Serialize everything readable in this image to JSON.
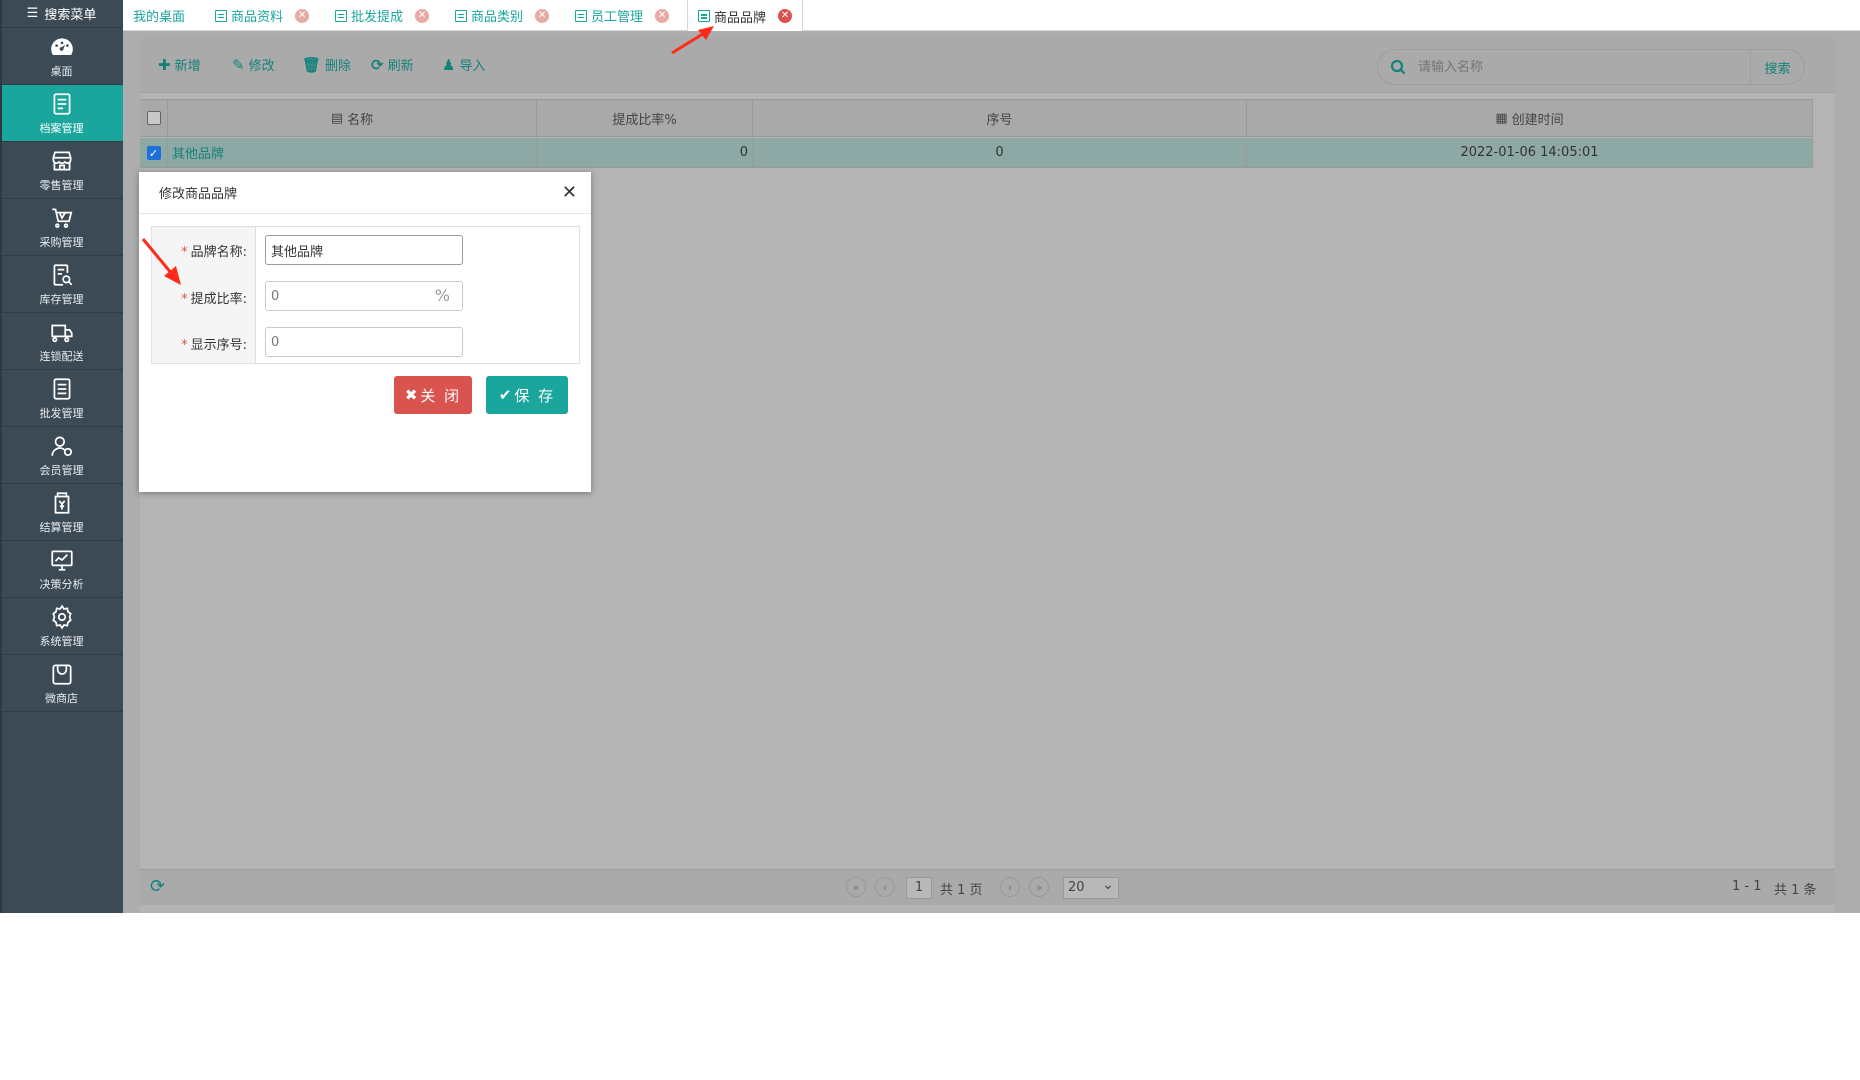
{
  "sidebar": {
    "search_label": "搜索菜单",
    "items": [
      {
        "label": "桌面",
        "icon": "dashboard-icon"
      },
      {
        "label": "档案管理",
        "icon": "archive-icon"
      },
      {
        "label": "零售管理",
        "icon": "store-icon"
      },
      {
        "label": "采购管理",
        "icon": "cart-icon"
      },
      {
        "label": "库存管理",
        "icon": "inventory-icon"
      },
      {
        "label": "连锁配送",
        "icon": "delivery-icon"
      },
      {
        "label": "批发管理",
        "icon": "wholesale-icon"
      },
      {
        "label": "会员管理",
        "icon": "member-icon"
      },
      {
        "label": "结算管理",
        "icon": "settlement-icon"
      },
      {
        "label": "决策分析",
        "icon": "analysis-icon"
      },
      {
        "label": "系统管理",
        "icon": "gear-icon"
      },
      {
        "label": "微商店",
        "icon": "shop-bag-icon"
      }
    ],
    "active_index": 1
  },
  "tabs": [
    {
      "label": "我的桌面"
    },
    {
      "label": "商品资料"
    },
    {
      "label": "批发提成"
    },
    {
      "label": "商品类别"
    },
    {
      "label": "员工管理"
    },
    {
      "label": "商品品牌"
    }
  ],
  "toolbar": {
    "add_label": "新增",
    "edit_label": "修改",
    "delete_label": "删除",
    "refresh_label": "刷新",
    "import_label": "导入",
    "search_placeholder": "请输入名称",
    "search_button": "搜索"
  },
  "grid": {
    "headers": {
      "name": "名称",
      "rate": "提成比率%",
      "order": "序号",
      "created": "创建时间"
    },
    "rows": [
      {
        "name": "其他品牌",
        "rate": "0",
        "order": "0",
        "created": "2022-01-06 14:05:01"
      }
    ]
  },
  "pager": {
    "page": "1",
    "total_pages": "共 1 页",
    "page_size": "20",
    "range": "1 - 1",
    "total": "共 1 条"
  },
  "dialog": {
    "title": "修改商品品牌",
    "fields": [
      {
        "label": "品牌名称:",
        "value": "其他品牌"
      },
      {
        "label": "提成比率:",
        "value": "0",
        "unit": "%"
      },
      {
        "label": "显示序号:",
        "value": "0"
      }
    ],
    "close_button": "关 闭",
    "save_button": "保 存"
  },
  "colors": {
    "accent": "#1aa59d",
    "danger": "#d9534f",
    "sidebar": "#3c4a56",
    "annotation": "#ff2a1a"
  }
}
